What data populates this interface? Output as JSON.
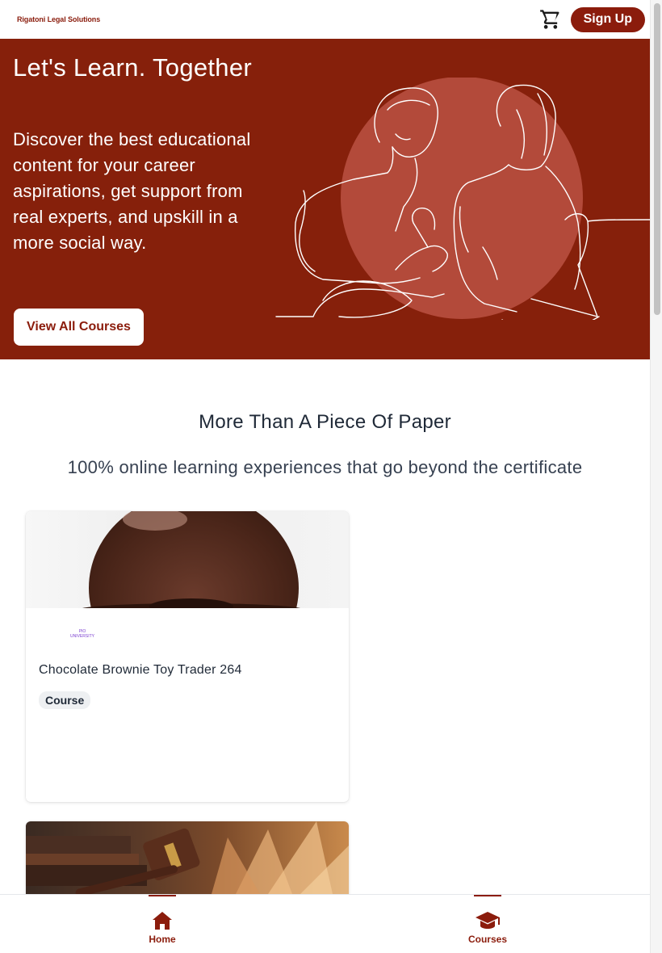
{
  "header": {
    "brand": "Rigatoni Legal Solutions",
    "cart_icon": "shopping-cart-icon",
    "signup_label": "Sign Up"
  },
  "hero": {
    "title": "Let's Learn. Together",
    "description": "Discover the best educational content for your career aspirations, get support from real experts, and upskill in a more social way.",
    "button_label": "View All Courses"
  },
  "section": {
    "title": "More Than A Piece Of Paper",
    "subtitle": "100% online learning experiences that go beyond the certificate"
  },
  "courses": [
    {
      "title": "Chocolate Brownie Toy Trader 264",
      "badge": "Course",
      "provider_logo_text": "PIO UNIVERSITY",
      "image_icon": "brownie-image"
    },
    {
      "title": "",
      "badge": "",
      "image_icon": "gavel-book-image"
    }
  ],
  "bottom_nav": {
    "items": [
      {
        "label": "Home",
        "icon": "home-icon",
        "active": true
      },
      {
        "label": "Courses",
        "icon": "graduation-cap-icon",
        "active": true
      }
    ]
  },
  "colors": {
    "brand": "#8b1c0c",
    "hero_bg": "#86200b",
    "hero_circle": "#b34a3a"
  }
}
